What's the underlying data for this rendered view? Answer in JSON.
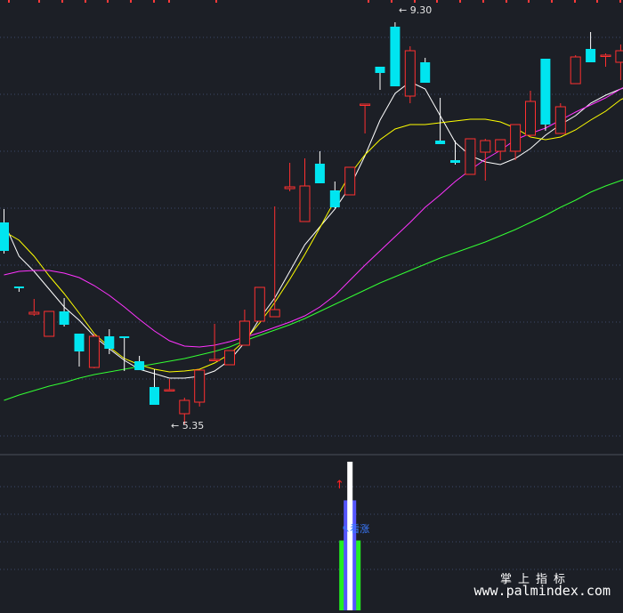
{
  "chart_data": [
    {
      "type": "candlestick",
      "panel": "main",
      "ylim": [
        4.55,
        9.6
      ],
      "annotations": {
        "high_label": "9.30",
        "low_label": "5.35",
        "high_arrow": "←",
        "low_arrow": "←"
      },
      "candles": [
        {
          "i": 0,
          "o": 7.1,
          "h": 7.25,
          "l": 6.75,
          "c": 6.78
        },
        {
          "i": 1,
          "o": 6.38,
          "h": 6.38,
          "l": 6.32,
          "c": 6.36
        },
        {
          "i": 2,
          "o": 6.07,
          "h": 6.24,
          "l": 6.05,
          "c": 6.09
        },
        {
          "i": 3,
          "o": 5.82,
          "h": 6.1,
          "l": 5.82,
          "c": 6.1
        },
        {
          "i": 4,
          "o": 6.1,
          "h": 6.25,
          "l": 5.93,
          "c": 5.95
        },
        {
          "i": 5,
          "o": 5.85,
          "h": 5.85,
          "l": 5.48,
          "c": 5.65
        },
        {
          "i": 6,
          "o": 5.47,
          "h": 5.85,
          "l": 5.46,
          "c": 5.82
        },
        {
          "i": 7,
          "o": 5.82,
          "h": 5.9,
          "l": 5.62,
          "c": 5.68
        },
        {
          "i": 8,
          "o": 5.82,
          "h": 5.82,
          "l": 5.43,
          "c": 5.8
        },
        {
          "i": 9,
          "o": 5.54,
          "h": 5.6,
          "l": 5.47,
          "c": 5.44
        },
        {
          "i": 10,
          "o": 5.25,
          "h": 5.45,
          "l": 5.2,
          "c": 5.05
        },
        {
          "i": 11,
          "o": 5.22,
          "h": 5.34,
          "l": 5.22,
          "c": 5.22
        },
        {
          "i": 12,
          "o": 4.95,
          "h": 5.13,
          "l": 4.83,
          "c": 5.1
        },
        {
          "i": 13,
          "o": 5.08,
          "h": 5.44,
          "l": 5.03,
          "c": 5.44
        },
        {
          "i": 14,
          "o": 5.56,
          "h": 5.96,
          "l": 5.56,
          "c": 5.56
        },
        {
          "i": 15,
          "o": 5.5,
          "h": 5.66,
          "l": 5.5,
          "c": 5.66
        },
        {
          "i": 16,
          "o": 5.72,
          "h": 6.12,
          "l": 5.72,
          "c": 5.99
        },
        {
          "i": 17,
          "o": 5.99,
          "h": 6.37,
          "l": 5.99,
          "c": 6.37
        },
        {
          "i": 18,
          "o": 6.04,
          "h": 7.28,
          "l": 6.04,
          "c": 6.12
        },
        {
          "i": 19,
          "o": 7.48,
          "h": 7.77,
          "l": 7.45,
          "c": 7.5
        },
        {
          "i": 20,
          "o": 7.11,
          "h": 7.82,
          "l": 7.11,
          "c": 7.51
        },
        {
          "i": 21,
          "o": 7.76,
          "h": 7.9,
          "l": 7.54,
          "c": 7.54
        },
        {
          "i": 22,
          "o": 7.46,
          "h": 7.56,
          "l": 7.26,
          "c": 7.27
        },
        {
          "i": 23,
          "o": 7.41,
          "h": 7.72,
          "l": 7.41,
          "c": 7.72
        },
        {
          "i": 24,
          "o": 8.43,
          "h": 8.43,
          "l": 8.1,
          "c": 8.43
        },
        {
          "i": 25,
          "o": 8.85,
          "h": 8.85,
          "l": 8.59,
          "c": 8.78
        },
        {
          "i": 26,
          "o": 9.3,
          "h": 9.35,
          "l": 8.63,
          "c": 8.63
        },
        {
          "i": 27,
          "o": 8.52,
          "h": 9.08,
          "l": 8.44,
          "c": 9.03
        },
        {
          "i": 28,
          "o": 8.9,
          "h": 8.95,
          "l": 8.67,
          "c": 8.67
        },
        {
          "i": 29,
          "o": 8.02,
          "h": 8.5,
          "l": 7.99,
          "c": 7.98
        },
        {
          "i": 30,
          "o": 7.8,
          "h": 8.02,
          "l": 7.75,
          "c": 7.77
        },
        {
          "i": 31,
          "o": 7.64,
          "h": 7.88,
          "l": 7.64,
          "c": 8.04
        },
        {
          "i": 32,
          "o": 7.89,
          "h": 8.04,
          "l": 7.57,
          "c": 8.02
        },
        {
          "i": 33,
          "o": 7.9,
          "h": 8.03,
          "l": 7.8,
          "c": 8.03
        },
        {
          "i": 34,
          "o": 7.9,
          "h": 8.03,
          "l": 7.8,
          "c": 8.2
        },
        {
          "i": 35,
          "o": 8.08,
          "h": 8.58,
          "l": 8.06,
          "c": 8.46
        },
        {
          "i": 36,
          "o": 8.94,
          "h": 8.94,
          "l": 8.13,
          "c": 8.2
        },
        {
          "i": 37,
          "o": 8.1,
          "h": 8.44,
          "l": 8.1,
          "c": 8.4
        },
        {
          "i": 38,
          "o": 8.66,
          "h": 8.98,
          "l": 8.66,
          "c": 8.96
        },
        {
          "i": 39,
          "o": 9.05,
          "h": 9.24,
          "l": 9.04,
          "c": 8.9
        },
        {
          "i": 40,
          "o": 8.98,
          "h": 9.0,
          "l": 8.85,
          "c": 8.98
        },
        {
          "i": 41,
          "o": 8.9,
          "h": 9.1,
          "l": 8.7,
          "c": 9.03
        },
        {
          "i": 42,
          "o": 9.15,
          "h": 9.25,
          "l": 8.8,
          "c": 8.8
        }
      ],
      "moving_averages": [
        {
          "color": "#ffffff",
          "values": [
            7.1,
            6.72,
            6.55,
            6.35,
            6.15,
            6.0,
            5.82,
            5.68,
            5.55,
            5.45,
            5.4,
            5.35,
            5.35,
            5.37,
            5.43,
            5.55,
            5.75,
            6.02,
            6.25,
            6.55,
            6.85,
            7.05,
            7.25,
            7.5,
            7.85,
            8.25,
            8.55,
            8.68,
            8.6,
            8.3,
            8.0,
            7.85,
            7.78,
            7.75,
            7.82,
            7.93,
            8.08,
            8.2,
            8.3,
            8.44,
            8.53,
            8.6,
            8.66
          ]
        },
        {
          "color": "#ffff00",
          "values": [
            7.0,
            6.9,
            6.72,
            6.5,
            6.3,
            6.08,
            5.85,
            5.7,
            5.57,
            5.5,
            5.45,
            5.42,
            5.43,
            5.45,
            5.52,
            5.62,
            5.77,
            5.97,
            6.2,
            6.46,
            6.74,
            7.04,
            7.35,
            7.64,
            7.86,
            8.03,
            8.15,
            8.2,
            8.2,
            8.22,
            8.24,
            8.26,
            8.26,
            8.23,
            8.16,
            8.06,
            8.03,
            8.06,
            8.14,
            8.25,
            8.35,
            8.48,
            8.56
          ]
        },
        {
          "color": "#ff33ff",
          "values": [
            6.51,
            6.55,
            6.56,
            6.56,
            6.53,
            6.48,
            6.39,
            6.28,
            6.15,
            6.01,
            5.88,
            5.77,
            5.71,
            5.7,
            5.72,
            5.76,
            5.81,
            5.86,
            5.92,
            5.98,
            6.05,
            6.15,
            6.28,
            6.45,
            6.62,
            6.78,
            6.94,
            7.1,
            7.27,
            7.41,
            7.56,
            7.69,
            7.81,
            7.91,
            8.03,
            8.1,
            8.16,
            8.25,
            8.34,
            8.42,
            8.5,
            8.6,
            8.69
          ]
        },
        {
          "color": "#33ff33",
          "values": [
            5.1,
            5.16,
            5.21,
            5.26,
            5.3,
            5.35,
            5.39,
            5.42,
            5.45,
            5.48,
            5.51,
            5.54,
            5.57,
            5.61,
            5.65,
            5.7,
            5.77,
            5.83,
            5.89,
            5.95,
            6.02,
            6.1,
            6.18,
            6.26,
            6.34,
            6.42,
            6.49,
            6.56,
            6.63,
            6.7,
            6.76,
            6.82,
            6.88,
            6.95,
            7.02,
            7.1,
            7.18,
            7.27,
            7.35,
            7.44,
            7.51,
            7.57,
            7.63
          ]
        }
      ]
    },
    {
      "type": "bar",
      "panel": "indicator",
      "label": "看涨",
      "signal_arrow": "↑",
      "bar": {
        "index": 23,
        "white": 1.0,
        "blue": 0.74,
        "green": 0.47
      }
    }
  ],
  "colors": {
    "background": "#1c1f26",
    "grid": "#3c4a6a",
    "panel_divider": "#4a4f5a",
    "up_candle": "#ff3030",
    "down_candle": "#00e5f0",
    "annotation_text": "#e6e6e6",
    "signal_label": "#3a7aff",
    "signal_arrow": "#ff2020",
    "bar_white": "#ffffff",
    "bar_blue": "#5555ff",
    "bar_green": "#22ee22"
  },
  "watermark": {
    "cn": "掌上指标",
    "url": "www.palmindex.com"
  }
}
